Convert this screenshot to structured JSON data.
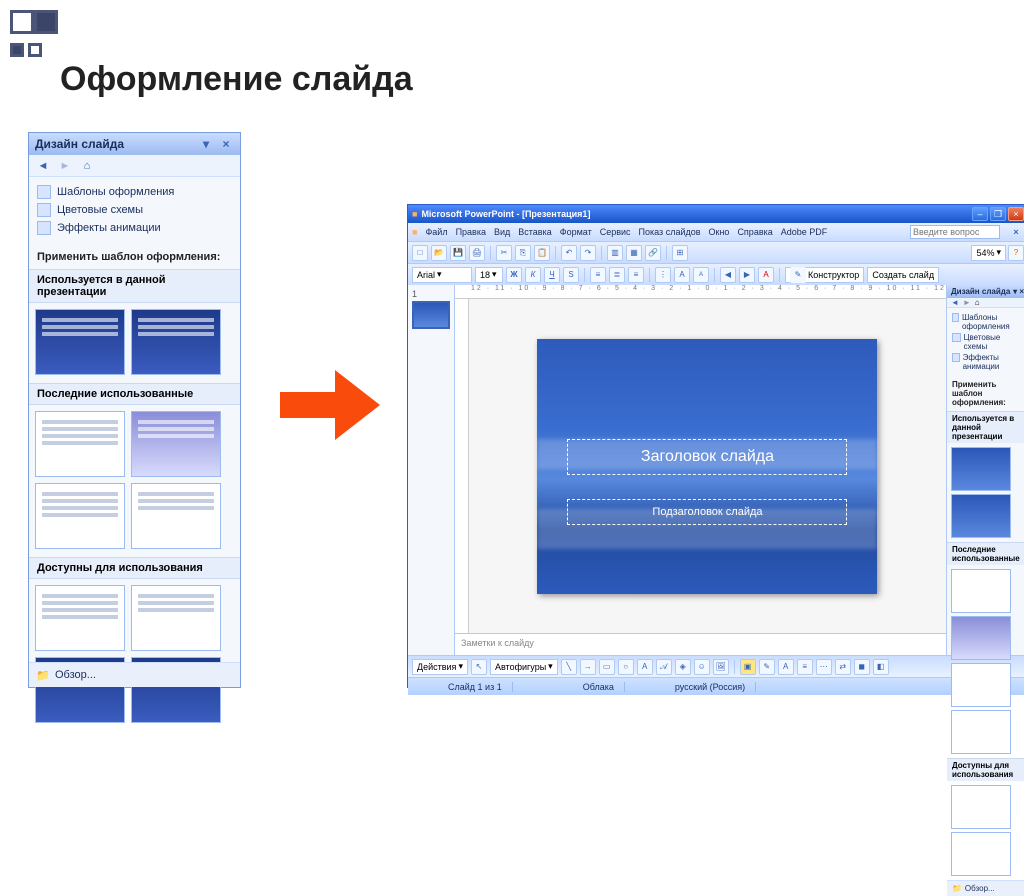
{
  "page": {
    "title": "Оформление слайда"
  },
  "taskpane": {
    "title": "Дизайн слайда",
    "links": [
      {
        "label": "Шаблоны оформления"
      },
      {
        "label": "Цветовые схемы"
      },
      {
        "label": "Эффекты анимации"
      }
    ],
    "apply_label": "Применить шаблон оформления:",
    "groups": [
      {
        "label": "Используется в данной презентации"
      },
      {
        "label": "Последние использованные"
      },
      {
        "label": "Доступны для использования"
      }
    ],
    "browse": "Обзор..."
  },
  "pp": {
    "titlebar": "Microsoft PowerPoint - [Презентация1]",
    "menu": [
      "Файл",
      "Правка",
      "Вид",
      "Вставка",
      "Формат",
      "Сервис",
      "Показ слайдов",
      "Окно",
      "Справка",
      "Adobe PDF"
    ],
    "ask_placeholder": "Введите вопрос",
    "font": {
      "name": "Arial",
      "size": "18"
    },
    "zoom": "54%",
    "designer": "Конструктор",
    "new_slide": "Создать слайд",
    "ruler_h": "12 · 11 · 10 · 9 · 8 · 7 · 6 · 5 · 4 · 3 · 2 · 1 · 0 · 1 · 2 · 3 · 4 · 5 · 6 · 7 · 8 · 9 · 10 · 11 · 12",
    "slide_num": "1",
    "slide": {
      "title": "Заголовок слайда",
      "subtitle": "Подзаголовок слайда"
    },
    "notes": "Заметки к слайду",
    "tp": {
      "title": "Дизайн слайда",
      "links": [
        "Шаблоны оформления",
        "Цветовые схемы",
        "Эффекты анимации"
      ],
      "apply": "Применить шаблон оформления:",
      "groups": [
        "Используется в данной презентации",
        "Последние использованные",
        "Доступны для использования"
      ],
      "browse": "Обзор..."
    },
    "draw": {
      "actions": "Действия",
      "autoshapes": "Автофигуры"
    },
    "status": {
      "slide": "Слайд 1 из 1",
      "theme": "Облака",
      "lang": "русский (Россия)"
    }
  }
}
